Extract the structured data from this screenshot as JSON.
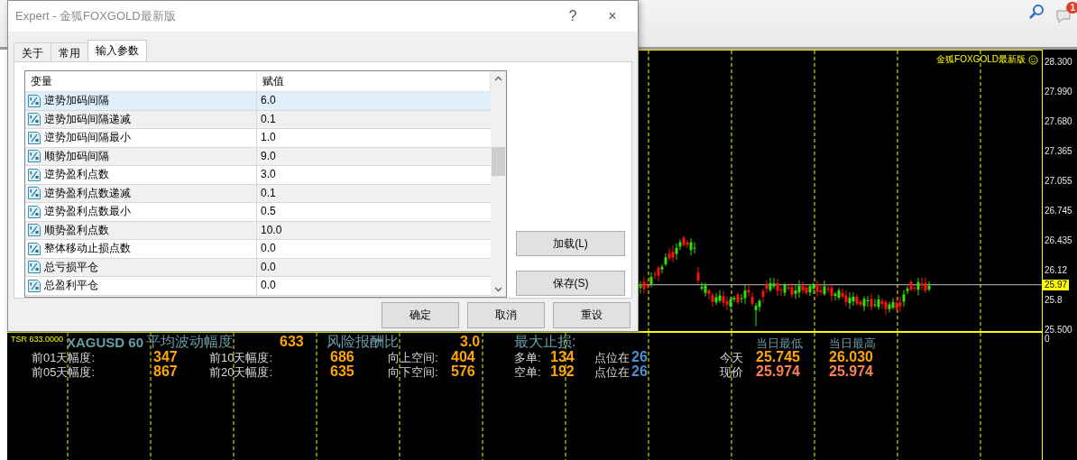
{
  "toolbar": {
    "notification_count": "1"
  },
  "chart": {
    "title": "金狐FOXGOLD最新版",
    "price_axis": [
      {
        "label": "28.300",
        "kind": "tick"
      },
      {
        "label": "27.990",
        "kind": "tick"
      },
      {
        "label": "27.680",
        "kind": "tick"
      },
      {
        "label": "27.365",
        "kind": "tick"
      },
      {
        "label": "27.055",
        "kind": "tick"
      },
      {
        "label": "26.745",
        "kind": "tick"
      },
      {
        "label": "26.435",
        "kind": "tick"
      },
      {
        "label": "26.12",
        "kind": "tick"
      },
      {
        "label": "25.97",
        "kind": "current"
      },
      {
        "label": "25.8",
        "kind": "tick"
      },
      {
        "label": "25.500",
        "kind": "tick"
      }
    ]
  },
  "indicator": {
    "tsr": "TSR 633.0000",
    "axis_label": "0",
    "labels": [
      {
        "text": "XAGUSD 60",
        "kind": "symbol"
      },
      {
        "text": "平均波动幅度",
        "kind": "header"
      },
      {
        "text": "633",
        "kind": "value"
      },
      {
        "text": "风险报酬比",
        "kind": "header"
      },
      {
        "text": "3.0",
        "kind": "value"
      },
      {
        "text": "最大止损:",
        "kind": "header"
      },
      {
        "text": "当日最低",
        "kind": "subheader"
      },
      {
        "text": "当日最高",
        "kind": "subheader"
      },
      {
        "text": "前01天幅度:",
        "kind": "label"
      },
      {
        "text": "347",
        "kind": "value"
      },
      {
        "text": "前10天幅度:",
        "kind": "label"
      },
      {
        "text": "686",
        "kind": "value"
      },
      {
        "text": "向上空间:",
        "kind": "label"
      },
      {
        "text": "404",
        "kind": "value"
      },
      {
        "text": "多单:",
        "kind": "label"
      },
      {
        "text": "134",
        "kind": "value"
      },
      {
        "text": "点位在",
        "kind": "label"
      },
      {
        "text": "26",
        "kind": "point"
      },
      {
        "text": "今天",
        "kind": "label"
      },
      {
        "text": "25.745",
        "kind": "value"
      },
      {
        "text": "26.030",
        "kind": "value"
      },
      {
        "text": "前05天幅度:",
        "kind": "label"
      },
      {
        "text": "867",
        "kind": "value"
      },
      {
        "text": "前20天幅度:",
        "kind": "label"
      },
      {
        "text": "635",
        "kind": "value"
      },
      {
        "text": "向下空间:",
        "kind": "label"
      },
      {
        "text": "576",
        "kind": "value"
      },
      {
        "text": "空单:",
        "kind": "label"
      },
      {
        "text": "192",
        "kind": "value"
      },
      {
        "text": "点位在",
        "kind": "label"
      },
      {
        "text": "26",
        "kind": "point"
      },
      {
        "text": "现价",
        "kind": "label"
      },
      {
        "text": "25.974",
        "kind": "price"
      },
      {
        "text": "25.974",
        "kind": "price"
      }
    ]
  },
  "dialog": {
    "title": "Expert - 金狐FOXGOLD最新版",
    "help": "?",
    "close": "×",
    "tabs": [
      {
        "label": "关于",
        "selected": false
      },
      {
        "label": "常用",
        "selected": false
      },
      {
        "label": "输入参数",
        "selected": true
      }
    ],
    "table": {
      "columns": [
        "变量",
        "赋值"
      ],
      "rows": [
        {
          "name": "逆势加码间隔",
          "value": "6.0",
          "selected": true
        },
        {
          "name": "逆势加码间隔递减",
          "value": "0.1",
          "selected": false
        },
        {
          "name": "逆势加码间隔最小",
          "value": "1.0",
          "selected": false
        },
        {
          "name": "顺势加码间隔",
          "value": "9.0",
          "selected": false
        },
        {
          "name": "逆势盈利点数",
          "value": "3.0",
          "selected": false
        },
        {
          "name": "逆势盈利点数递减",
          "value": "0.1",
          "selected": false
        },
        {
          "name": "逆势盈利点数最小",
          "value": "0.5",
          "selected": false
        },
        {
          "name": "顺势盈利点数",
          "value": "10.0",
          "selected": false
        },
        {
          "name": "整体移动止损点数",
          "value": "0.0",
          "selected": false
        },
        {
          "name": "总亏损平仓",
          "value": "0.0",
          "selected": false
        },
        {
          "name": "总盈利平仓",
          "value": "0.0",
          "selected": false
        }
      ]
    },
    "side_buttons": [
      "加载(L)",
      "保存(S)"
    ],
    "buttons": [
      "确定",
      "取消",
      "重设"
    ]
  }
}
